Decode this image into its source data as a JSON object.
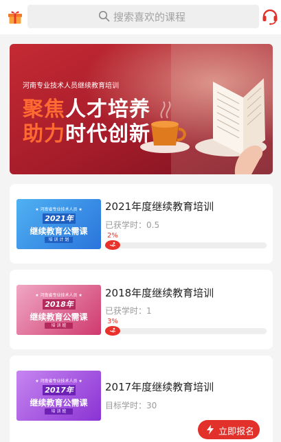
{
  "header": {
    "search_placeholder": "搜索喜欢的课程",
    "gift_icon": "gift-icon",
    "support_icon": "headset-icon"
  },
  "banner": {
    "subtitle": "河南专业技术人员继续教育培训",
    "line1_highlight": "聚焦",
    "line1_rest": "人才培养",
    "line2_highlight": "助力",
    "line2_rest": "时代创新"
  },
  "courses": [
    {
      "title": "2021年度继续教育培训",
      "meta": "已获学时：0.5",
      "progress_label": "2%",
      "progress": 0.02,
      "thumb": {
        "top": "★ 河南省专业技术人员 ★",
        "year": "2021年",
        "title": "继续教育公需课",
        "tag": "培 训 计 划"
      }
    },
    {
      "title": "2018年度继续教育培训",
      "meta": "已获学时：1",
      "progress_label": "3%",
      "progress": 0.03,
      "thumb": {
        "top": "★ 河南省专业技术人员 ★",
        "year": "2018年",
        "title": "继续教育公需课",
        "tag": "培 训 班"
      }
    },
    {
      "title": "2017年度继续教育培训",
      "meta": "目标学时：30",
      "thumb": {
        "top": "★ 河南省专业技术人员 ★",
        "year": "2017年",
        "title": "继续教育公需课",
        "tag": "培 训 班"
      },
      "enroll_label": "立即报名"
    }
  ],
  "colors": {
    "accent": "#e1312a",
    "banner_red": "#b51f2c",
    "thumb_2021": "#2f8de4",
    "thumb_2018": "#d6457d",
    "thumb_2017": "#8f3fd6"
  }
}
